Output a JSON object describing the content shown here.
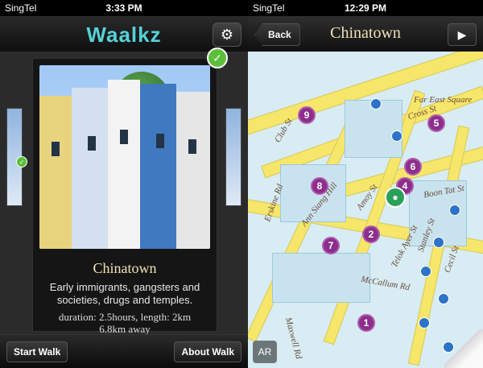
{
  "left": {
    "status": {
      "carrier": "SingTel",
      "time": "3:33 PM"
    },
    "brand": "Waalkz",
    "card": {
      "title": "Chinatown",
      "description": "Early immigrants, gangsters and societies, drugs and temples.",
      "duration_line": "duration: 2.5hours, length: 2km",
      "distance_line": "6.8km away"
    },
    "buttons": {
      "start": "Start Walk",
      "about": "About Walk"
    }
  },
  "right": {
    "status": {
      "carrier": "SingTel",
      "time": "12:29 PM"
    },
    "header": {
      "back": "Back",
      "title": "Chinatown"
    },
    "map": {
      "markers": [
        "9",
        "5",
        "6",
        "4",
        "8",
        "2",
        "7",
        "1"
      ],
      "streets": [
        "Club St",
        "Cross St",
        "Boon Tat St",
        "Amoy St",
        "Telok Ayer St",
        "McCallum Rd",
        "Cecil St",
        "Stanley St",
        "Maxwell Rd",
        "Erskine Rd",
        "Ann Siang Hill",
        "Far East Square"
      ],
      "ar_label": "AR"
    }
  }
}
